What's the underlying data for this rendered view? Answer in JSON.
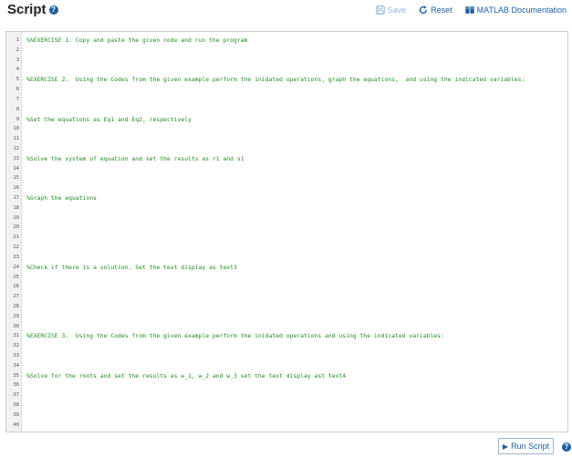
{
  "header": {
    "title": "Script",
    "toolbar": {
      "save_label": "Save",
      "reset_label": "Reset",
      "docs_label": "MATLAB Documentation"
    }
  },
  "editor": {
    "lines": [
      "%%EXERCISE 1: Copy and paste the given code and run the program",
      "",
      "",
      "",
      "%EXERCISE 2.  Using the Codes from the given example perform the inidated operations, graph the equations,  and using the indicated variables:",
      "",
      "",
      "",
      "%Set the equations as Eq1 and Eq2, respectively",
      "",
      "",
      "",
      "%Solve the system of equation and set the results as r1 and s1",
      "",
      "",
      "",
      "%Graph the equations",
      "",
      "",
      "",
      "",
      "",
      "",
      "%Check if there is a solution. Set the text display as text3",
      "",
      "",
      "",
      "",
      "",
      "",
      "%EXERCISE 3.  Using the Codes from the given example perform the inidated operations and using the indicated variables:",
      "",
      "",
      "",
      "%Solve for the roots and set the results as w_1, w_2 and w_3 set the text display ast text4",
      "",
      "",
      "",
      "",
      ""
    ]
  },
  "footer": {
    "run_label": "Run Script"
  },
  "colors": {
    "accent": "#1f5fa0",
    "comment": "#228b22",
    "disabled": "#9ab8d6"
  }
}
